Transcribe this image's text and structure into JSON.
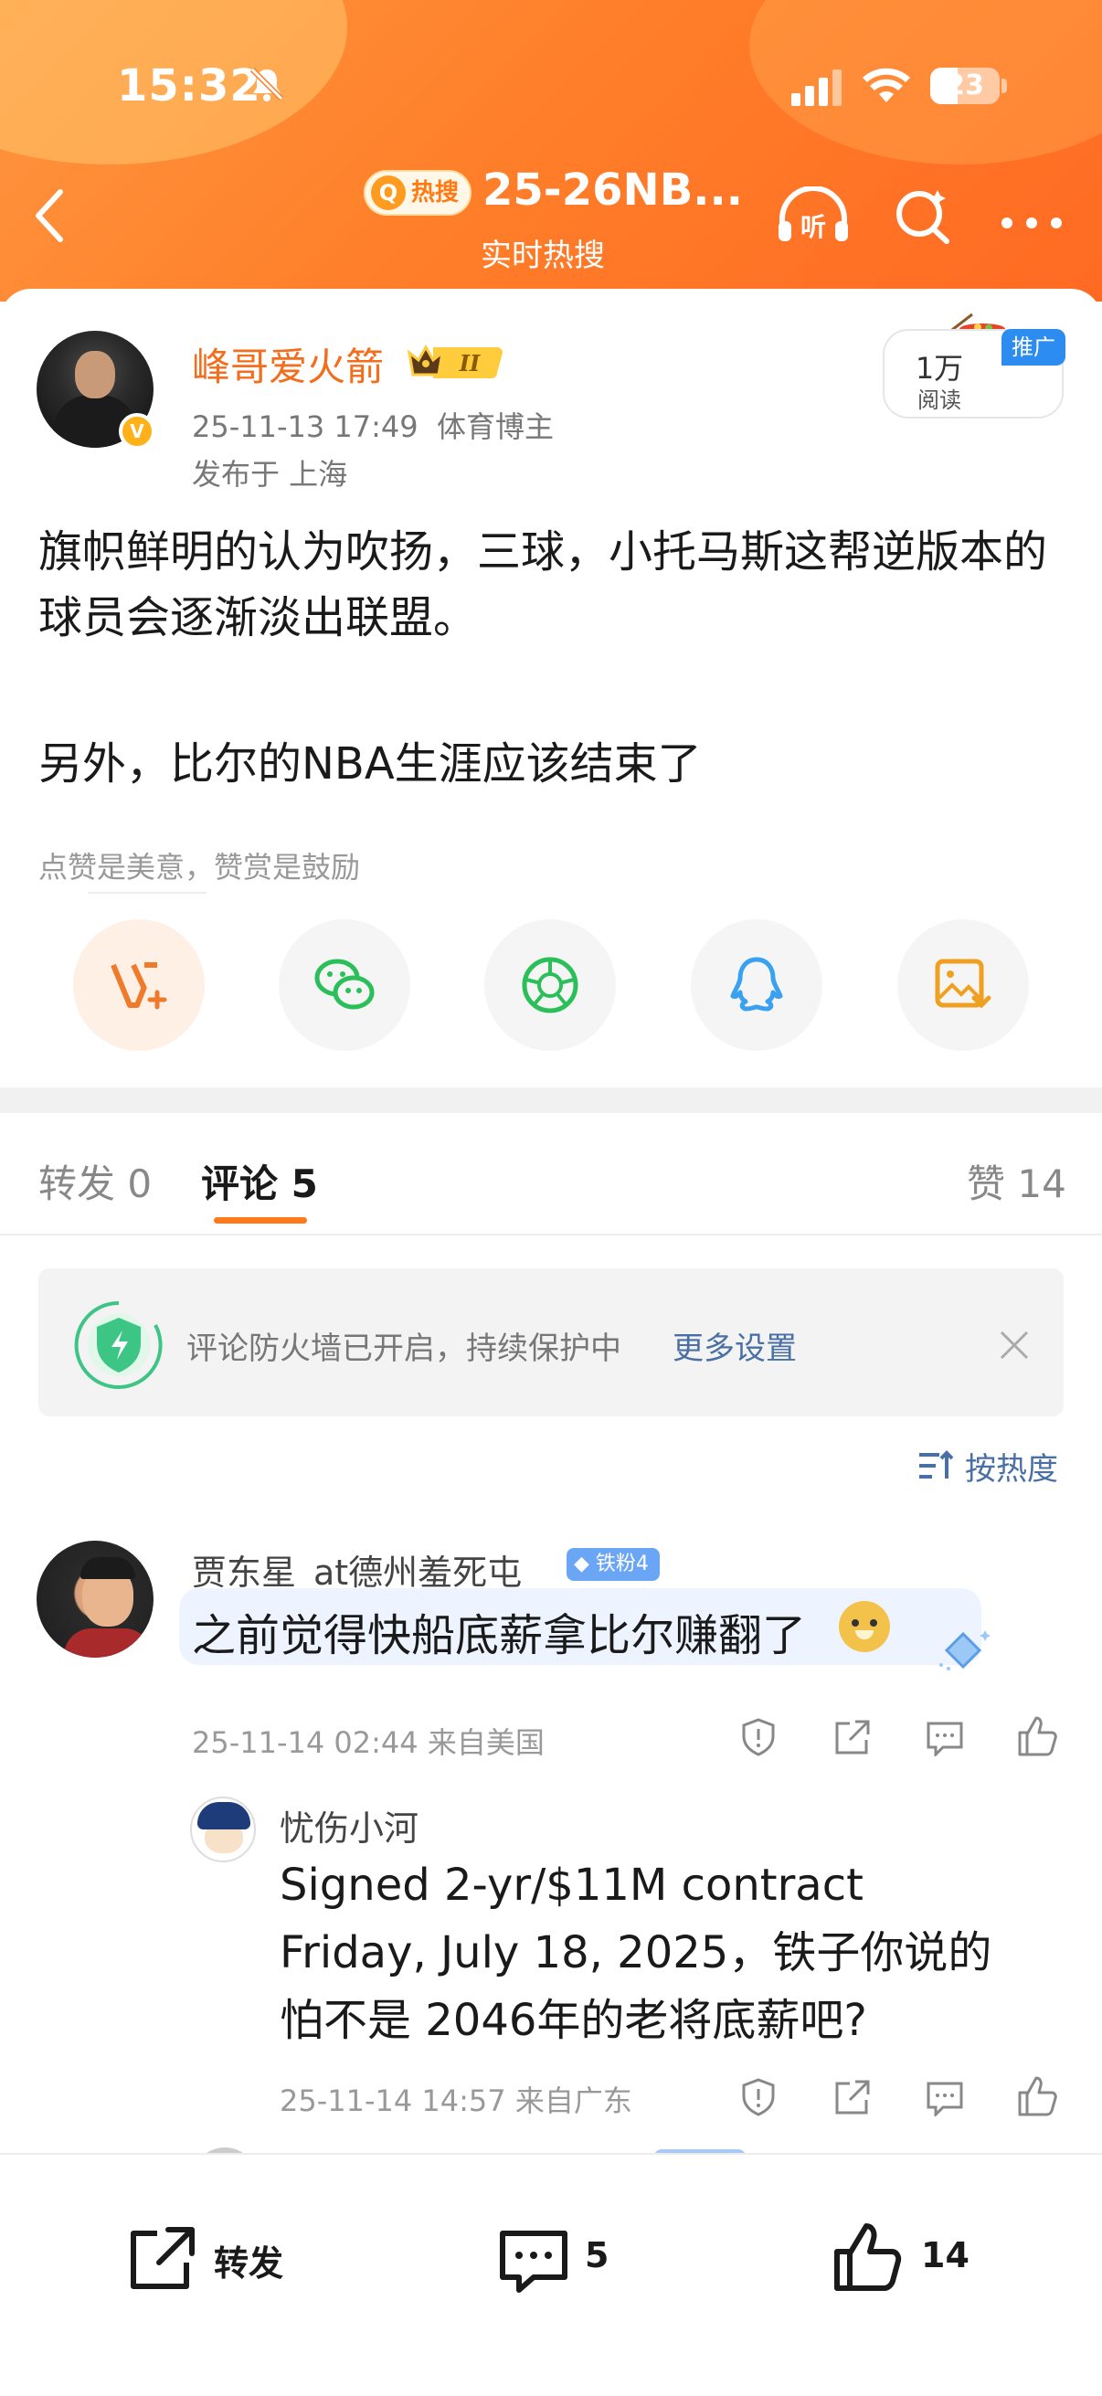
{
  "status_bar": {
    "time": "15:32",
    "battery": "23"
  },
  "header": {
    "hot_tag": "热搜",
    "title": "25-26NB...",
    "subtitle": "实时热搜"
  },
  "post": {
    "author": "峰哥爱火箭",
    "level_badge": "II",
    "date": "25-11-13 17:49",
    "author_role": "体育博主",
    "location": "发布于 上海",
    "reads": "1万",
    "reads_label": "阅读",
    "ad_tag": "推广",
    "paragraph1": "旗帜鲜明的认为吹扬，三球，小托马斯这帮逆版本的球员会逐渐淡出联盟。",
    "paragraph2": "另外，比尔的NBA生涯应该结束了",
    "reward_hint": "点赞是美意，赞赏是鼓励"
  },
  "tabs": {
    "repost": "转发 0",
    "comments": "评论 5",
    "likes": "赞 14"
  },
  "notice": {
    "text": "评论防火墙已开启，持续保护中",
    "link": "更多设置"
  },
  "sort_label": "按热度",
  "comments": [
    {
      "name": "贾东星_at德州羞死屯",
      "fan_badge": "铁粉4",
      "text": "之前觉得快船底薪拿比尔赚翻了",
      "meta": "25-11-14 02:44 来自美国"
    },
    {
      "name": "忧伤小河",
      "text": "Signed 2-yr/$11M contract Friday, July 18, 2025，铁子你说的怕不是 2046年的老将底薪吧?",
      "meta": "25-11-14 14:57 来自广东"
    }
  ],
  "bottom_bar": {
    "repost": "转发",
    "comments": "5",
    "likes": "14"
  },
  "colors": {
    "accent": "#ff7a1a",
    "username": "#f36d1c",
    "link": "#4a6fa5"
  }
}
